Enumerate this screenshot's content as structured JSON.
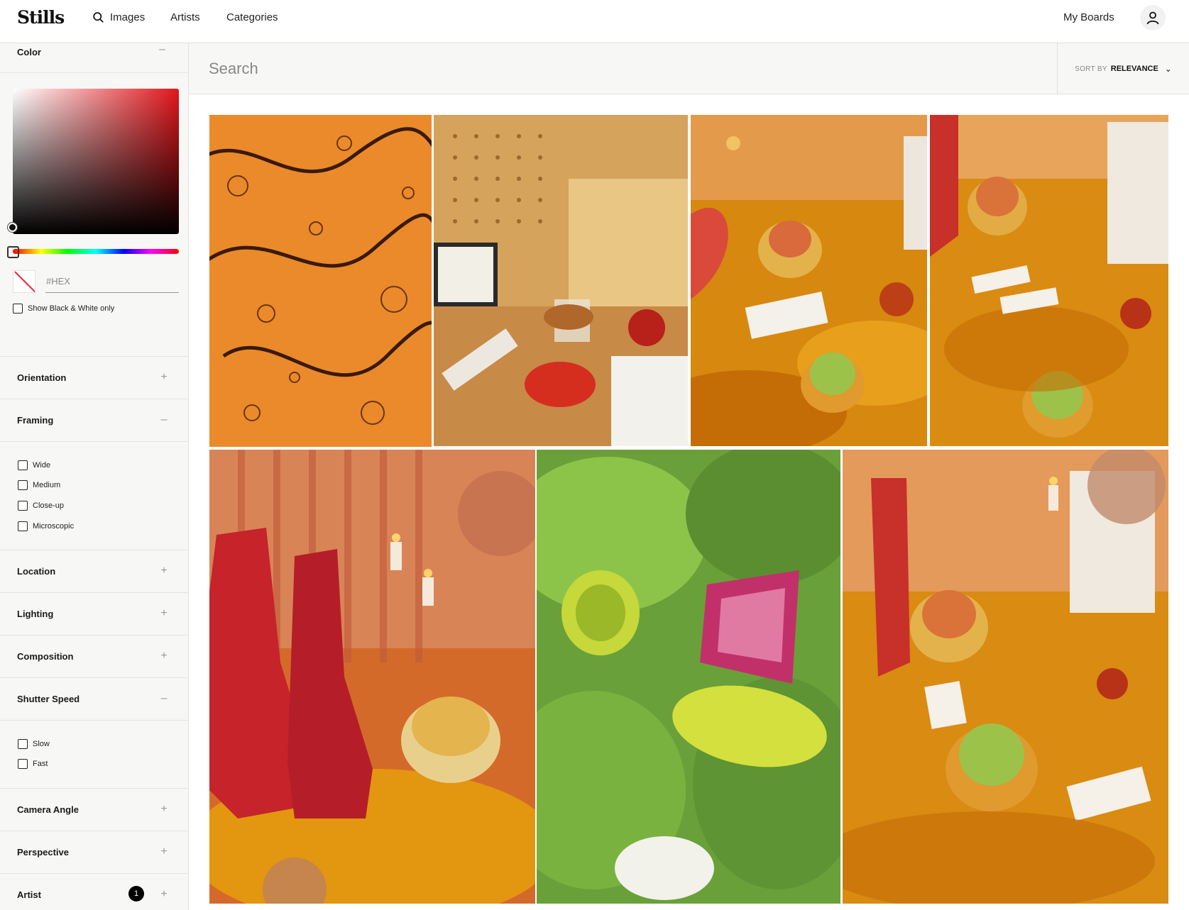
{
  "nav": {
    "logo": "Stills",
    "images_label": "Images",
    "artists_label": "Artists",
    "categories_label": "Categories",
    "boards_label": "My Boards"
  },
  "sidebar": {
    "color": {
      "label": "Color",
      "toggle": "–",
      "hex_placeholder": "#HEX",
      "bw_label": "Show Black & White only",
      "picker_base_color": "#e1161b"
    },
    "orientation": {
      "label": "Orientation",
      "toggle": "+"
    },
    "framing": {
      "label": "Framing",
      "toggle": "–",
      "options": [
        "Wide",
        "Medium",
        "Close-up",
        "Microscopic"
      ]
    },
    "location": {
      "label": "Location",
      "toggle": "+"
    },
    "lighting": {
      "label": "Lighting",
      "toggle": "+"
    },
    "composition": {
      "label": "Composition",
      "toggle": "+"
    },
    "shutter_speed": {
      "label": "Shutter Speed",
      "toggle": "–",
      "options": [
        "Slow",
        "Fast"
      ]
    },
    "camera_angle": {
      "label": "Camera Angle",
      "toggle": "+"
    },
    "perspective": {
      "label": "Perspective",
      "toggle": "+"
    },
    "artist": {
      "label": "Artist",
      "toggle": "+",
      "count": "1"
    }
  },
  "search": {
    "placeholder": "Search",
    "sort_prefix": "SORT BY",
    "sort_value": "RELEVANCE"
  },
  "gallery": {
    "images": [
      "orange-bubbles-macro",
      "pegboard-desk-still-life",
      "gold-satin-party-table",
      "gold-satin-party-table-wide",
      "red-cowboy-boots-candles",
      "green-salad-radish-macro",
      "party-table-disco-ball"
    ]
  }
}
